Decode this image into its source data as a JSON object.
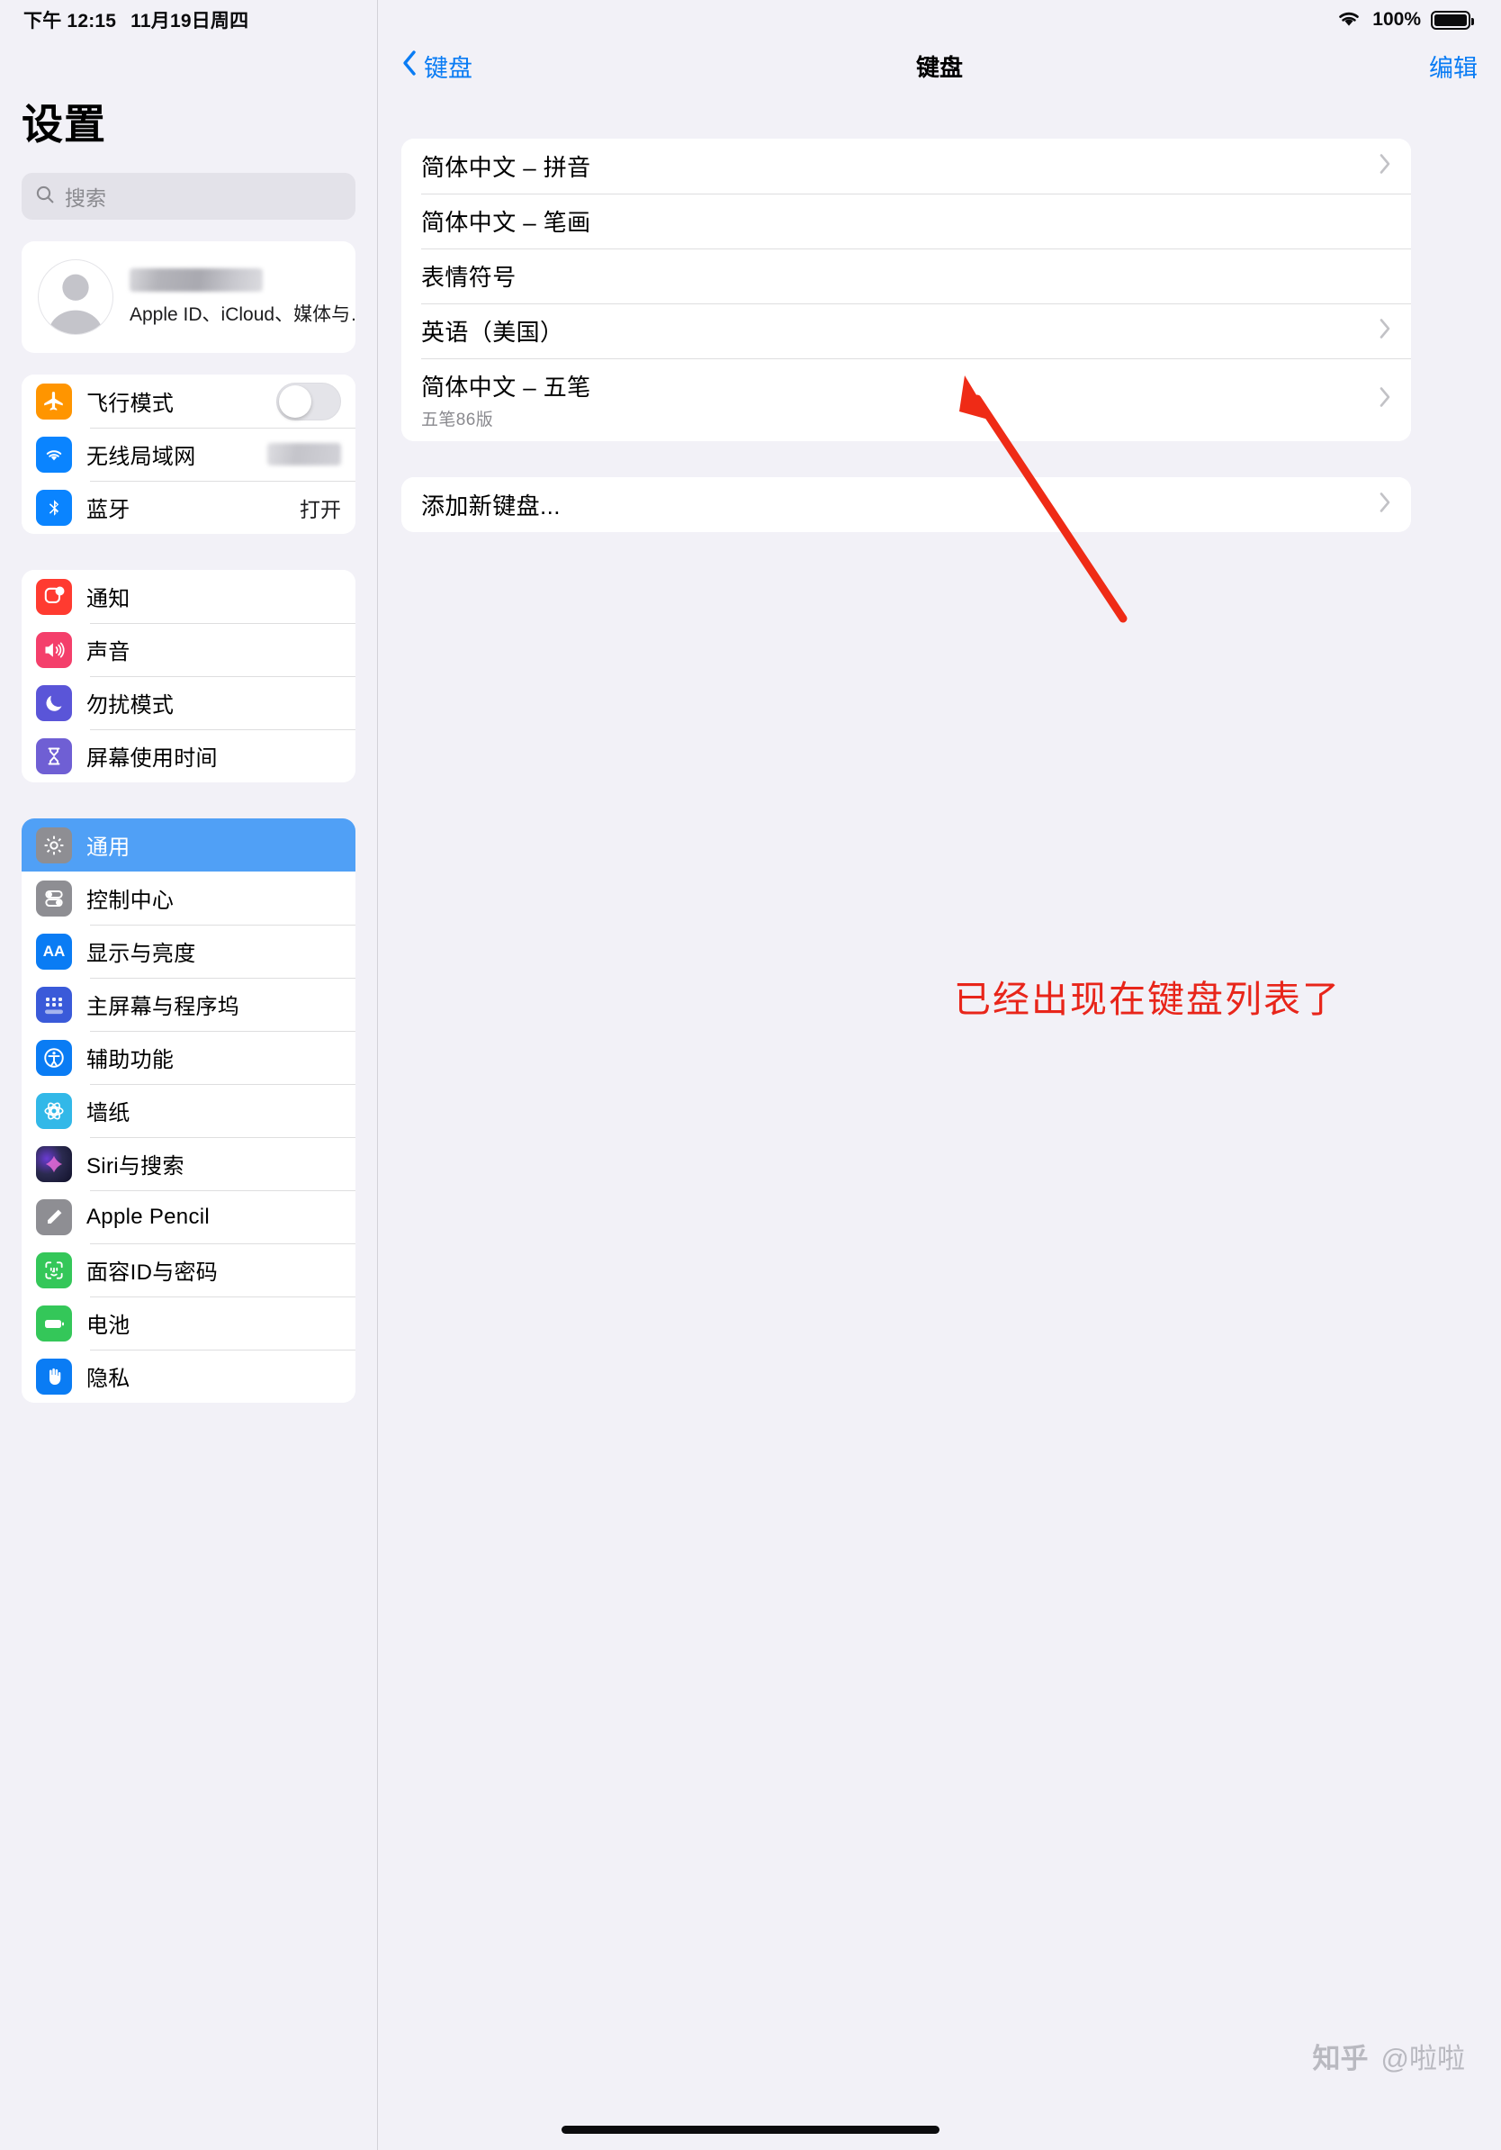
{
  "status_bar": {
    "time": "下午 12:15",
    "date": "11月19日周四",
    "wifi_icon": "wifi-icon",
    "battery_percent": "100%",
    "battery_icon": "battery-full-icon"
  },
  "sidebar": {
    "title": "设置",
    "search": {
      "placeholder": "搜索",
      "icon": "search-icon"
    },
    "account": {
      "name_redacted": "",
      "subtitle": "Apple ID、iCloud、媒体与…",
      "avatar_icon": "person-avatar-icon"
    },
    "groups": [
      {
        "items": [
          {
            "label": "飞行模式",
            "icon": "airplane-icon",
            "color": "#ff9500",
            "accessory": "toggle-off"
          },
          {
            "label": "无线局域网",
            "icon": "wifi-icon",
            "color": "#0a84ff",
            "accessory": "redacted-value"
          },
          {
            "label": "蓝牙",
            "icon": "bluetooth-icon",
            "color": "#0a84ff",
            "accessory": "value",
            "value": "打开"
          }
        ]
      },
      {
        "items": [
          {
            "label": "通知",
            "icon": "notifications-icon",
            "color": "#ff3b30",
            "accessory": "none"
          },
          {
            "label": "声音",
            "icon": "sound-icon",
            "color": "#f43f6b",
            "accessory": "none"
          },
          {
            "label": "勿扰模式",
            "icon": "moon-icon",
            "color": "#5a55d8",
            "accessory": "none"
          },
          {
            "label": "屏幕使用时间",
            "icon": "hourglass-icon",
            "color": "#6f5fd4",
            "accessory": "none"
          }
        ]
      },
      {
        "items": [
          {
            "label": "通用",
            "icon": "gear-icon",
            "color": "#8e8e93",
            "accessory": "none",
            "selected": true
          },
          {
            "label": "控制中心",
            "icon": "sliders-icon",
            "color": "#8e8e93",
            "accessory": "none"
          },
          {
            "label": "显示与亮度",
            "icon": "display-aa-icon",
            "color": "#0a7cf4",
            "accessory": "none"
          },
          {
            "label": "主屏幕与程序坞",
            "icon": "home-screen-icon",
            "color": "#3a5ad9",
            "accessory": "none"
          },
          {
            "label": "辅助功能",
            "icon": "accessibility-icon",
            "color": "#0a7cf4",
            "accessory": "none"
          },
          {
            "label": "墙纸",
            "icon": "wallpaper-icon",
            "color": "#32b8e8",
            "accessory": "none"
          },
          {
            "label": "Siri与搜索",
            "icon": "siri-icon",
            "color": "#2b2b40",
            "accessory": "none"
          },
          {
            "label": "Apple Pencil",
            "icon": "pencil-icon",
            "color": "#8e8e93",
            "accessory": "none"
          },
          {
            "label": "面容ID与密码",
            "icon": "face-id-icon",
            "color": "#34c759",
            "accessory": "none"
          },
          {
            "label": "电池",
            "icon": "battery-icon",
            "color": "#34c759",
            "accessory": "none"
          },
          {
            "label": "隐私",
            "icon": "privacy-hand-icon",
            "color": "#0a7cf4",
            "accessory": "none"
          }
        ]
      }
    ]
  },
  "detail": {
    "nav": {
      "back_label": "键盘",
      "back_icon": "chevron-left-icon",
      "title": "键盘",
      "edit_label": "编辑"
    },
    "keyboard_list": [
      {
        "title": "简体中文 – 拼音",
        "subtitle": "",
        "chevron": true
      },
      {
        "title": "简体中文 – 笔画",
        "subtitle": "",
        "chevron": false
      },
      {
        "title": "表情符号",
        "subtitle": "",
        "chevron": false
      },
      {
        "title": "英语（美国）",
        "subtitle": "",
        "chevron": true
      },
      {
        "title": "简体中文 – 五笔",
        "subtitle": "五笔86版",
        "chevron": true
      }
    ],
    "add_keyboard": {
      "title": "添加新键盘...",
      "chevron": true
    },
    "annotation": {
      "text": "已经出现在键盘列表了",
      "color": "#e8251a",
      "arrow_icon": "red-arrow-icon"
    }
  },
  "watermark": {
    "logo": "知乎",
    "handle": "@啦啦"
  }
}
